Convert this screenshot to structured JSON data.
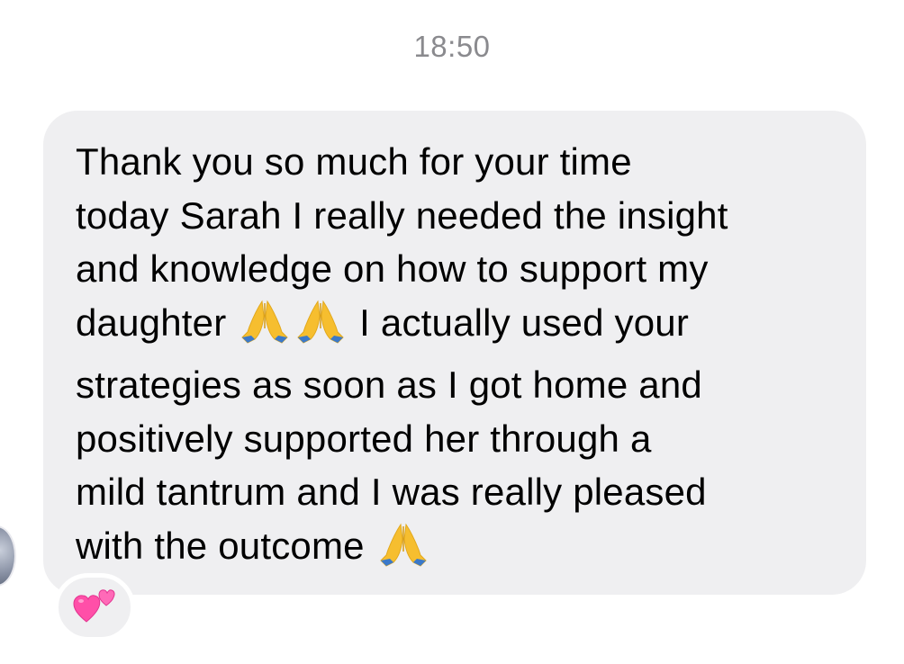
{
  "conversation": {
    "timestamp": "18:50"
  },
  "message": {
    "lines": [
      "Thank you so much for your time",
      "today Sarah I really needed the insight",
      "and knowledge on how to support my",
      "daughter",
      "I actually used your",
      "strategies as soon as I got home and",
      "positively supported her through a",
      "mild tantrum and I was really pleased",
      "with the outcome"
    ],
    "emojis": [
      "folded-hands-emoji",
      "folded-hands-emoji",
      "folded-hands-emoji"
    ]
  },
  "reaction": {
    "emoji": "two-hearts-emoji"
  },
  "colors": {
    "bubble": "#efeff1",
    "timestamp": "#8a8a8e",
    "text": "#000000"
  }
}
